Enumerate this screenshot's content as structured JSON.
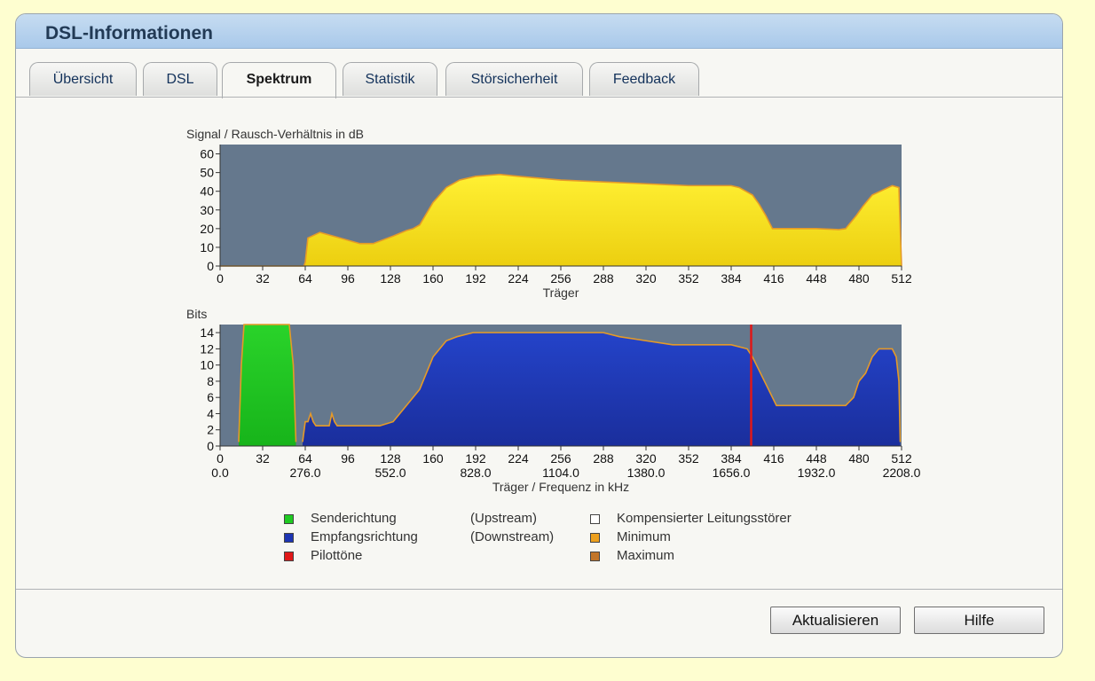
{
  "panel": {
    "title": "DSL-Informationen"
  },
  "tabs": [
    {
      "label": "Übersicht",
      "active": false
    },
    {
      "label": "DSL",
      "active": false
    },
    {
      "label": "Spektrum",
      "active": true
    },
    {
      "label": "Statistik",
      "active": false
    },
    {
      "label": "Störsicherheit",
      "active": false
    },
    {
      "label": "Feedback",
      "active": false
    }
  ],
  "chart_data": [
    {
      "type": "area",
      "title": "Signal / Rausch-Verhältnis in dB",
      "xlabel": "Träger",
      "ylabel": "",
      "xlim": [
        0,
        512
      ],
      "ylim": [
        0,
        65
      ],
      "xticks": [
        0,
        32,
        64,
        96,
        128,
        160,
        192,
        224,
        256,
        288,
        320,
        352,
        384,
        416,
        448,
        480,
        512
      ],
      "yticks": [
        0,
        10,
        20,
        30,
        40,
        50,
        60
      ],
      "grid": false,
      "colors": {
        "fill": "#f2dc19",
        "line": "#e59a28",
        "plot_bg": "#65788d"
      },
      "series": [
        {
          "x": [
            0,
            63,
            64,
            66,
            75,
            90,
            105,
            115,
            130,
            140,
            145,
            150,
            155,
            160,
            170,
            180,
            192,
            210,
            224,
            240,
            256,
            288,
            320,
            352,
            370,
            384,
            390,
            400,
            405,
            410,
            415,
            430,
            448,
            465,
            470,
            478,
            483,
            490,
            505,
            510,
            511,
            512
          ],
          "y": [
            0,
            0,
            2,
            15,
            18,
            15,
            12,
            12,
            16,
            19,
            20,
            22,
            28,
            34,
            42,
            46,
            48,
            49,
            48,
            47,
            46,
            45,
            44,
            43,
            43,
            43,
            42,
            38,
            33,
            27,
            20,
            20,
            20,
            19.5,
            20,
            27,
            32,
            38,
            43,
            42,
            20,
            0
          ]
        }
      ]
    },
    {
      "type": "area",
      "title": "Bits",
      "xlabel": "Träger / Frequenz in kHz",
      "ylabel": "",
      "xlim": [
        0,
        512
      ],
      "ylim": [
        0,
        15
      ],
      "xticks": [
        0,
        32,
        64,
        96,
        128,
        160,
        192,
        224,
        256,
        288,
        320,
        352,
        384,
        416,
        448,
        480,
        512
      ],
      "xticks_secondary": [
        "0.0",
        "276.0",
        "552.0",
        "828.0",
        "1104.0",
        "1380.0",
        "1656.0",
        "1932.0",
        "2208.0"
      ],
      "yticks": [
        0,
        2,
        4,
        6,
        8,
        10,
        12,
        14
      ],
      "grid": false,
      "colors": {
        "upstream": "#1fca22",
        "downstream": "#1d35b3",
        "pilot": "#e01818",
        "minmax_line": "#e59a28",
        "plot_bg": "#65788d"
      },
      "series": [
        {
          "name": "Senderichtung",
          "x": [
            14,
            16,
            18,
            52,
            55,
            57
          ],
          "y": [
            0.5,
            10,
            15,
            15,
            10,
            0.5
          ]
        },
        {
          "name": "Empfangsrichtung",
          "x": [
            62,
            64,
            66,
            68,
            70,
            72,
            82,
            84,
            86,
            88,
            92,
            120,
            130,
            135,
            140,
            145,
            150,
            155,
            160,
            165,
            170,
            178,
            190,
            200,
            215,
            224,
            256,
            288,
            300,
            320,
            340,
            352,
            384,
            396,
            400,
            406,
            412,
            418,
            420,
            440,
            450,
            465,
            470,
            476,
            480,
            485,
            490,
            495,
            500,
            505,
            508,
            510,
            511
          ],
          "y": [
            0.5,
            3,
            3,
            4,
            3,
            2.5,
            2.5,
            4,
            3,
            2.5,
            2.5,
            2.5,
            3,
            4,
            5,
            6,
            7,
            9,
            11,
            12,
            13,
            13.5,
            14,
            14,
            14,
            14,
            14,
            14,
            13.5,
            13,
            12.5,
            12.5,
            12.5,
            12,
            11,
            9,
            7,
            5,
            5,
            5,
            5,
            5,
            5,
            6,
            8,
            9,
            11,
            12,
            12,
            12,
            11,
            8,
            0.5
          ]
        }
      ],
      "pilot_tone_x": 399
    }
  ],
  "legend": [
    {
      "label": "Senderichtung",
      "suffix": "(Upstream)",
      "color": "#1fca22"
    },
    {
      "label": "Empfangsrichtung",
      "suffix": "(Downstream)",
      "color": "#1d35b3"
    },
    {
      "label": "Pilottöne",
      "suffix": "",
      "color": "#e01818"
    },
    {
      "label": "Kompensierter Leitungsstörer",
      "suffix": "",
      "color": "#ffffff"
    },
    {
      "label": "Minimum",
      "suffix": "",
      "color": "#eda01e"
    },
    {
      "label": "Maximum",
      "suffix": "",
      "color": "#c2752a"
    }
  ],
  "buttons": {
    "refresh": "Aktualisieren",
    "help": "Hilfe"
  }
}
